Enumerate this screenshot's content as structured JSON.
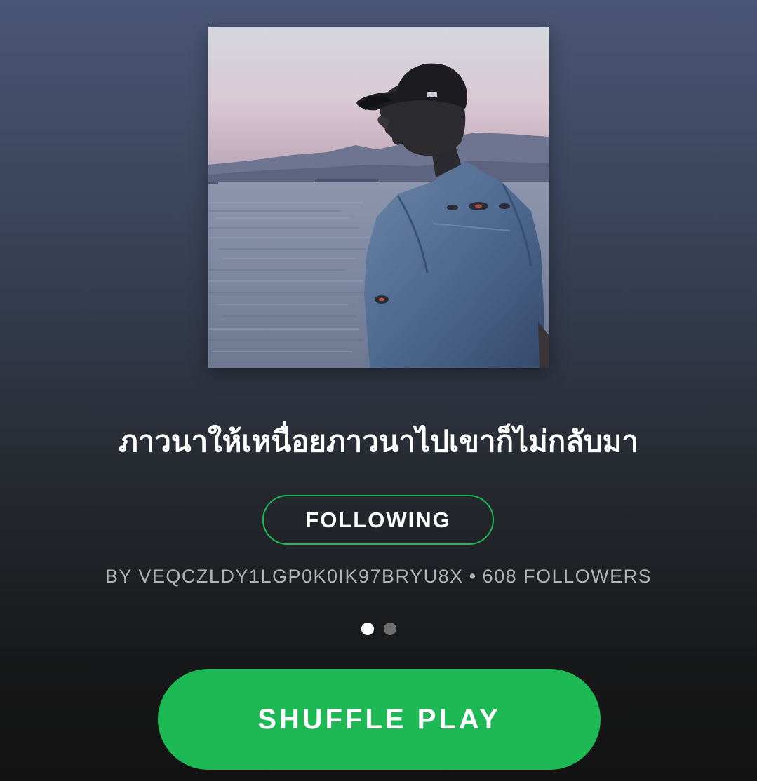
{
  "playlist": {
    "title": "ภาวนาให้เหนื่อยภาวนาไปเขาก็ไม่กลับมา",
    "follow_button_label": "FOLLOWING",
    "by_text": "BY VEQCZLDY1LGP0K0IK97BRYU8X",
    "separator": "•",
    "followers_text": "608 FOLLOWERS",
    "shuffle_button_label": "SHUFFLE PLAY"
  },
  "pager": {
    "active_index": 0,
    "count": 2
  },
  "colors": {
    "accent": "#1db954",
    "meta_text": "#b3b3b3",
    "dot_active": "#ffffff",
    "dot_inactive": "#6e6e6e"
  },
  "cover_image": {
    "semantic": "photo-man-in-cap-and-denim-jacket-by-sea-at-dusk"
  }
}
